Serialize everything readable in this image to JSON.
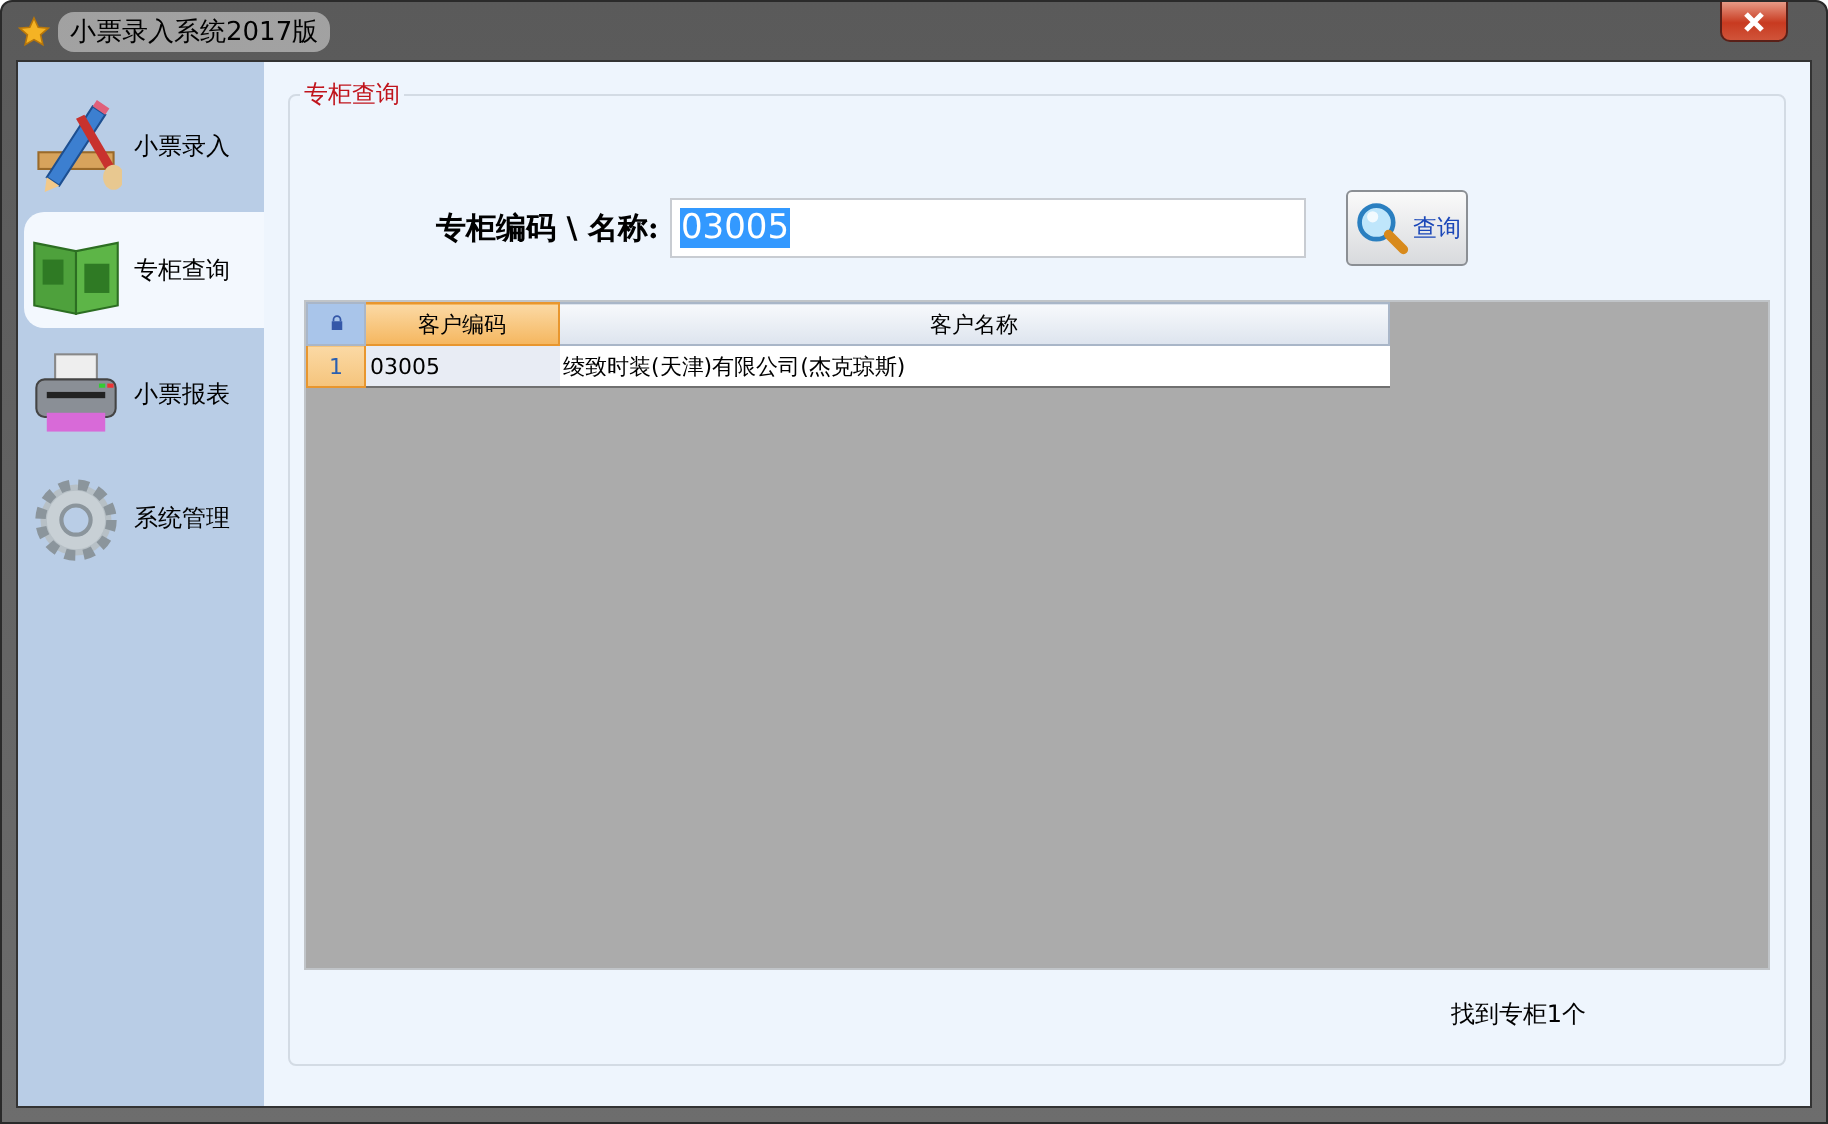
{
  "window": {
    "title": "小票录入系统2017版"
  },
  "sidebar": {
    "items": [
      {
        "label": "小票录入",
        "kind": "pencil",
        "selected": false
      },
      {
        "label": "专柜查询",
        "kind": "book",
        "selected": true
      },
      {
        "label": "小票报表",
        "kind": "printer",
        "selected": false
      },
      {
        "label": "系统管理",
        "kind": "gear",
        "selected": false
      }
    ]
  },
  "group": {
    "title": "专柜查询"
  },
  "search": {
    "label": "专柜编码 \\ 名称:",
    "value": "03005",
    "value_selected": true,
    "button": "查询"
  },
  "table": {
    "columns": [
      {
        "label": "客户编码",
        "selected": true
      },
      {
        "label": "客户名称",
        "selected": false
      }
    ],
    "rows": [
      {
        "number": "1",
        "selected": true,
        "cells": [
          "03005",
          "绫致时装(天津)有限公司(杰克琼斯)"
        ]
      }
    ]
  },
  "status": "找到专柜1个"
}
